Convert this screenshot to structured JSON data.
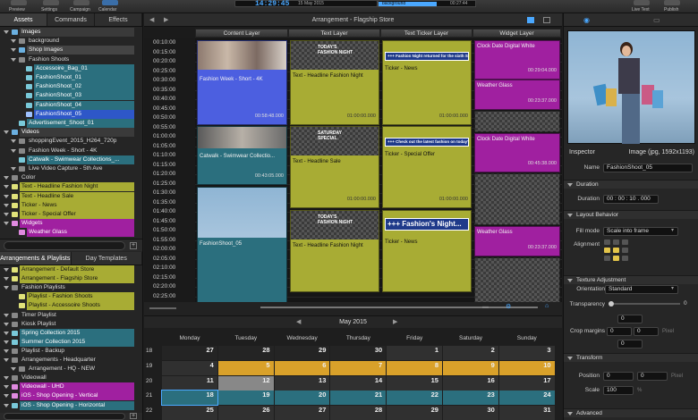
{
  "toolbar": {
    "preview_label": "Preview",
    "settings_label": "Settings",
    "campaign_label": "Campaign",
    "calendar_label": "Calendar",
    "clock_time": "14:29:45",
    "clock_date": "15 May 2015",
    "playing_label": "background",
    "playing_time": "00:27:44",
    "live_text_label": "Live Text",
    "publish_label": "Publish",
    "playback_progress": 0.6
  },
  "left": {
    "tabs": [
      "Assets",
      "Commands",
      "Effects"
    ],
    "tree": [
      {
        "label": "Images",
        "indent": 0,
        "style": "selected-dark"
      },
      {
        "label": "background",
        "indent": 1,
        "style": "plain"
      },
      {
        "label": "Shop Images",
        "indent": 1,
        "style": "folder-dark"
      },
      {
        "label": "Fashion Shoots",
        "indent": 1,
        "style": "plain"
      },
      {
        "label": "Accessoire_Bag_01",
        "indent": 2,
        "style": "teal"
      },
      {
        "label": "FashionShoot_01",
        "indent": 2,
        "style": "teal"
      },
      {
        "label": "FashionShoot_02",
        "indent": 2,
        "style": "teal"
      },
      {
        "label": "FashionShoot_03",
        "indent": 2,
        "style": "teal"
      },
      {
        "label": "FashionShoot_04",
        "indent": 2,
        "style": "teal"
      },
      {
        "label": "FashionShoot_05",
        "indent": 2,
        "style": "blue"
      },
      {
        "label": "Advertisement_Shoot_01",
        "indent": 1,
        "style": "teal"
      },
      {
        "label": "Videos",
        "indent": 0,
        "style": "selected-dark"
      },
      {
        "label": "shoppingEvent_2015_H264_720p",
        "indent": 1,
        "style": "plain"
      },
      {
        "label": "Fashion Week - Short - 4K",
        "indent": 1,
        "style": "plain"
      },
      {
        "label": "Catwalk - Swimwear Collections_...",
        "indent": 1,
        "style": "teal"
      },
      {
        "label": "Live Video Capture - 5th Ave",
        "indent": 1,
        "style": "plain"
      },
      {
        "label": "Color",
        "indent": 0,
        "style": "plain"
      },
      {
        "label": "Text - Headline Fashion Night",
        "indent": 0,
        "style": "olive"
      },
      {
        "label": "Text - Headline Sale",
        "indent": 0,
        "style": "olive"
      },
      {
        "label": "Ticker - News",
        "indent": 0,
        "style": "olive"
      },
      {
        "label": "Ticker - Special Offer",
        "indent": 0,
        "style": "olive"
      },
      {
        "label": "Widgets",
        "indent": 0,
        "style": "magenta"
      },
      {
        "label": "Weather Glass",
        "indent": 1,
        "style": "magenta"
      }
    ],
    "lower_tabs": [
      "Arrangements & Playlists",
      "Day Templates"
    ],
    "arrangements": [
      {
        "label": "Arrangement - Default Store",
        "indent": 0,
        "style": "olive"
      },
      {
        "label": "Arrangement - Flagship Store",
        "indent": 0,
        "style": "olive"
      },
      {
        "label": "Fashion Playlists",
        "indent": 0,
        "style": "plain"
      },
      {
        "label": "Playlist - Fashion Shoots",
        "indent": 1,
        "style": "olive"
      },
      {
        "label": "Playlist - Accessoire Shoots",
        "indent": 1,
        "style": "olive"
      },
      {
        "label": "Timer Playlist",
        "indent": 0,
        "style": "plain"
      },
      {
        "label": "Kiosk Playlist",
        "indent": 0,
        "style": "plain"
      },
      {
        "label": "Spring Collection 2015",
        "indent": 0,
        "style": "teal"
      },
      {
        "label": "Summer Collection 2015",
        "indent": 0,
        "style": "teal"
      },
      {
        "label": "Playlist - Backup",
        "indent": 0,
        "style": "plain"
      },
      {
        "label": "Arrangements - Headquarter",
        "indent": 0,
        "style": "plain"
      },
      {
        "label": "Arrangement - HQ - NEW",
        "indent": 1,
        "style": "plain"
      },
      {
        "label": "Videowall",
        "indent": 0,
        "style": "plain"
      },
      {
        "label": "Videowall - UHD",
        "indent": 0,
        "style": "magenta"
      },
      {
        "label": "iOS - Shop Opening - Vertical",
        "indent": 0,
        "style": "magenta"
      },
      {
        "label": "iOS - Shop Opening - Horizontal",
        "indent": 0,
        "style": "teal"
      }
    ]
  },
  "arrangement": {
    "title": "Arrangement - Flagship Store",
    "columns": [
      "Content Layer",
      "Text Layer",
      "Text Ticker Layer",
      "Widget Layer"
    ],
    "times": [
      "00:10:00",
      "00:15:00",
      "00:20:00",
      "00:25:00",
      "00:30:00",
      "00:35:00",
      "00:40:00",
      "00:45:00",
      "00:50:00",
      "00:55:00",
      "01:00:00",
      "01:05:00",
      "01:10:00",
      "01:15:00",
      "01:20:00",
      "01:25:00",
      "01:30:00",
      "01:35:00",
      "01:40:00",
      "01:45:00",
      "01:50:00",
      "01:55:00",
      "02:00:00",
      "02:05:00",
      "02:10:00",
      "02:15:00",
      "02:20:00",
      "02:25:00",
      "02:30:00",
      "02:35:00"
    ],
    "content_blocks": [
      {
        "label": "Fashion Week - Short - 4K",
        "duration": "00:58:48.000"
      },
      {
        "label": "Catwalk - Swimwear Collectio...",
        "duration": "00:43:05.000"
      },
      {
        "label": "FashionShoot_05",
        "duration": ""
      }
    ],
    "text_blocks": [
      {
        "label": "Text - Headline Fashion Night",
        "overlay": "TODAY'S FASHION NIGHT",
        "duration": "01:00:00.000"
      },
      {
        "label": "Text - Headline Sale",
        "overlay": "SATURDAY SPECIAL",
        "duration": "01:00:00.000"
      },
      {
        "label": "Text - Headline Fashion Night",
        "overlay": "TODAY'S FASHION NIGHT",
        "duration": ""
      }
    ],
    "ticker_blocks": [
      {
        "label": "Ticker - News",
        "overlay": "+++ Fashion Night returned for the sixth S...",
        "duration": "01:00:00.000"
      },
      {
        "label": "Ticker - Special Offer",
        "overlay": "+++ Check out the latest fashion on today's Sp...",
        "duration": "01:00:00.000"
      },
      {
        "label": "Ticker - News",
        "overlay": "+++ Fashion's Night...",
        "duration": ""
      }
    ],
    "widget_blocks": [
      {
        "label": "Clock Date Digital White",
        "duration": "00:29:04.000"
      },
      {
        "label": "Weather Glass",
        "duration": "00:23:37.000"
      },
      {
        "label": "Clock Date Digital White",
        "duration": "00:45:38.000"
      },
      {
        "label": "Weather Glass",
        "duration": "00:23:37.000"
      }
    ]
  },
  "calendar": {
    "month": "May 2015",
    "weekdays": [
      "Monday",
      "Tuesday",
      "Wednesday",
      "Thursday",
      "Friday",
      "Saturday",
      "Sunday"
    ],
    "weeks": [
      {
        "num": "18",
        "days": [
          "27",
          "28",
          "29",
          "30",
          "1",
          "2",
          "3"
        ]
      },
      {
        "num": "19",
        "days": [
          "4",
          "5",
          "6",
          "7",
          "8",
          "9",
          "10"
        ]
      },
      {
        "num": "20",
        "days": [
          "11",
          "12",
          "13",
          "14",
          "15",
          "16",
          "17"
        ]
      },
      {
        "num": "21",
        "days": [
          "18",
          "19",
          "20",
          "21",
          "22",
          "23",
          "24"
        ]
      },
      {
        "num": "22",
        "days": [
          "25",
          "26",
          "27",
          "28",
          "29",
          "30",
          "31"
        ]
      }
    ]
  },
  "inspector": {
    "title": "Inspector",
    "type": "Image (jpg, 1592x1193)",
    "name_label": "Name",
    "name_value": "FashionShoot_05",
    "duration_section": "Duration",
    "duration_label": "Duration",
    "duration_value": "00 : 00 : 10 . 000",
    "layout_section": "Layout Behavior",
    "fill_mode_label": "Fill mode",
    "fill_mode_value": "Scale into frame",
    "alignment_label": "Alignment",
    "texture_section": "Texture Adjustment",
    "orientation_label": "Orientation",
    "orientation_value": "Standard",
    "transparency_label": "Transparency",
    "transparency_value": "0",
    "crop_label": "Crop margins",
    "crop_top": "0",
    "crop_left": "0",
    "crop_right": "0",
    "crop_bottom": "0",
    "pixel_unit": "Pixel",
    "transform_section": "Transform",
    "position_label": "Position",
    "position_x": "0",
    "position_y": "0",
    "scale_label": "Scale",
    "scale_value": "100",
    "percent_unit": "%",
    "advanced_section": "Advanced"
  }
}
